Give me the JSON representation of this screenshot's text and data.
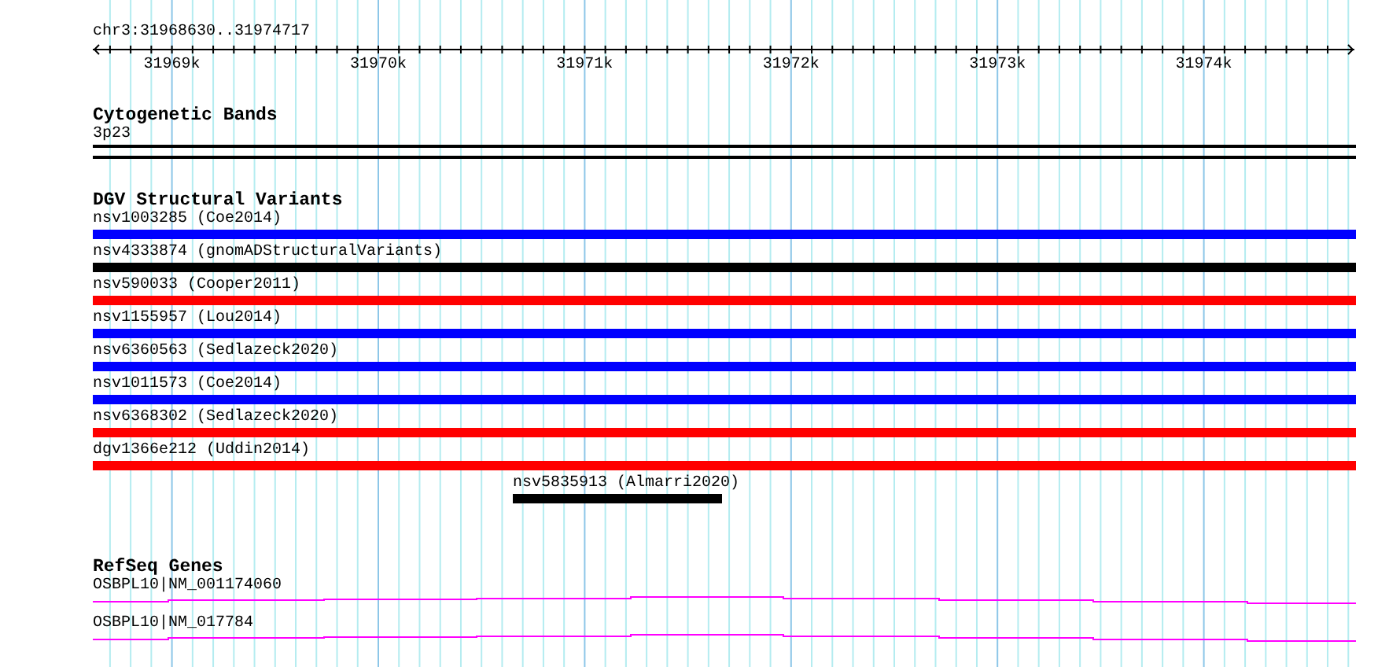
{
  "ruler": {
    "location": "chr3:31968630..31974717",
    "ticks": [
      "31969k",
      "31970k",
      "31971k",
      "31972k",
      "31973k",
      "31974k"
    ]
  },
  "tracks": [
    {
      "kind": "cytoband",
      "title": "Cytogenetic Bands",
      "features": [
        {
          "label": "3p23"
        }
      ]
    },
    {
      "kind": "variants",
      "title": "DGV Structural Variants",
      "features": [
        {
          "label": "nsv1003285 (Coe2014)",
          "color": "#0000ff",
          "kind": "full"
        },
        {
          "label": "nsv4333874 (gnomADStructuralVariants)",
          "color": "#000000",
          "kind": "full"
        },
        {
          "label": "nsv590033 (Cooper2011)",
          "color": "#ff0000",
          "kind": "full"
        },
        {
          "label": "nsv1155957 (Lou2014)",
          "color": "#0000ff",
          "kind": "full"
        },
        {
          "label": "nsv6360563 (Sedlazeck2020)",
          "color": "#0000ff",
          "kind": "full"
        },
        {
          "label": "nsv1011573 (Coe2014)",
          "color": "#0000ff",
          "kind": "full"
        },
        {
          "label": "nsv6368302 (Sedlazeck2020)",
          "color": "#ff0000",
          "kind": "full"
        },
        {
          "label": "dgv1366e212 (Uddin2014)",
          "color": "#ff0000",
          "kind": "full"
        },
        {
          "label": "nsv5835913 (Almarri2020)",
          "color": "#000000",
          "kind": "partial"
        }
      ]
    },
    {
      "kind": "genes",
      "title": "RefSeq Genes",
      "features": [
        {
          "label": "OSBPL10|NM_001174060"
        },
        {
          "label": "OSBPL10|NM_017784"
        }
      ]
    }
  ]
}
